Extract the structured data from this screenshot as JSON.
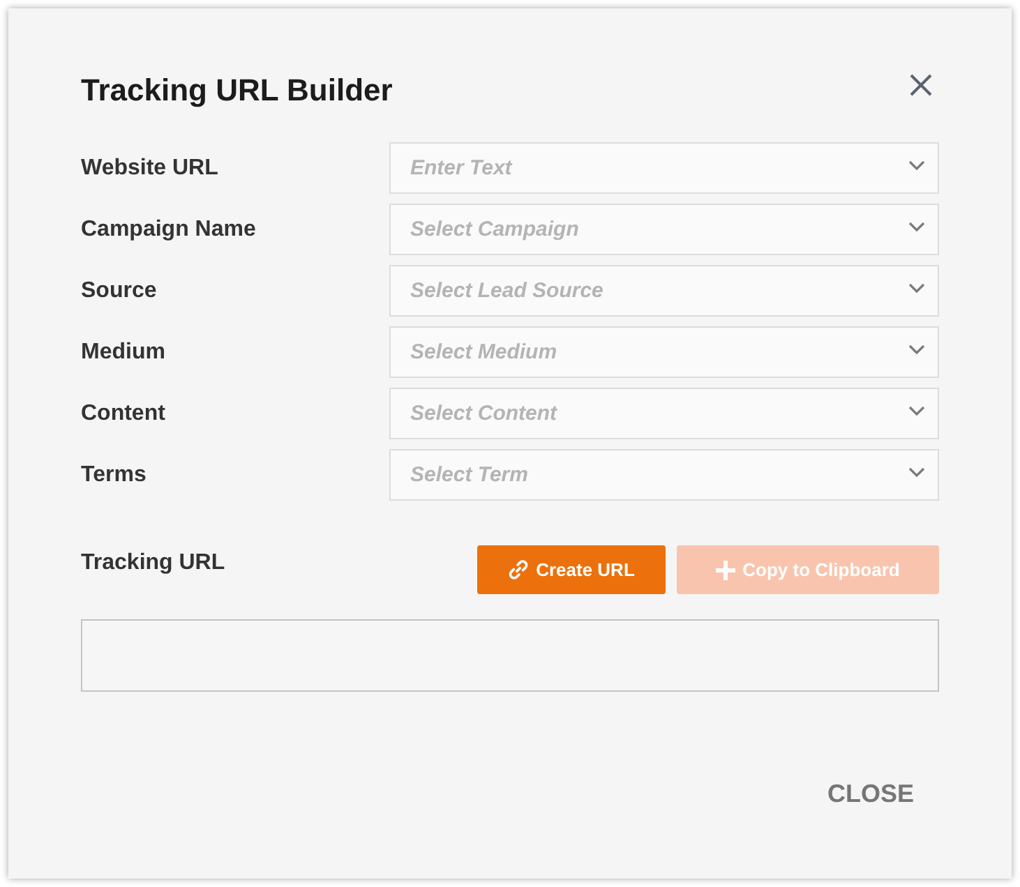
{
  "dialog": {
    "title": "Tracking URL Builder"
  },
  "fields": [
    {
      "label": "Website URL",
      "placeholder": "Enter Text"
    },
    {
      "label": "Campaign Name",
      "placeholder": "Select Campaign"
    },
    {
      "label": "Source",
      "placeholder": "Select Lead Source"
    },
    {
      "label": "Medium",
      "placeholder": "Select Medium"
    },
    {
      "label": "Content",
      "placeholder": "Select Content"
    },
    {
      "label": "Terms",
      "placeholder": "Select Term"
    }
  ],
  "output": {
    "label": "Tracking URL",
    "buttons": [
      {
        "label": "Create URL",
        "disabled": false
      },
      {
        "label": "Copy to Clipboard",
        "disabled": true
      }
    ]
  },
  "footer": {
    "close": "CLOSE"
  }
}
